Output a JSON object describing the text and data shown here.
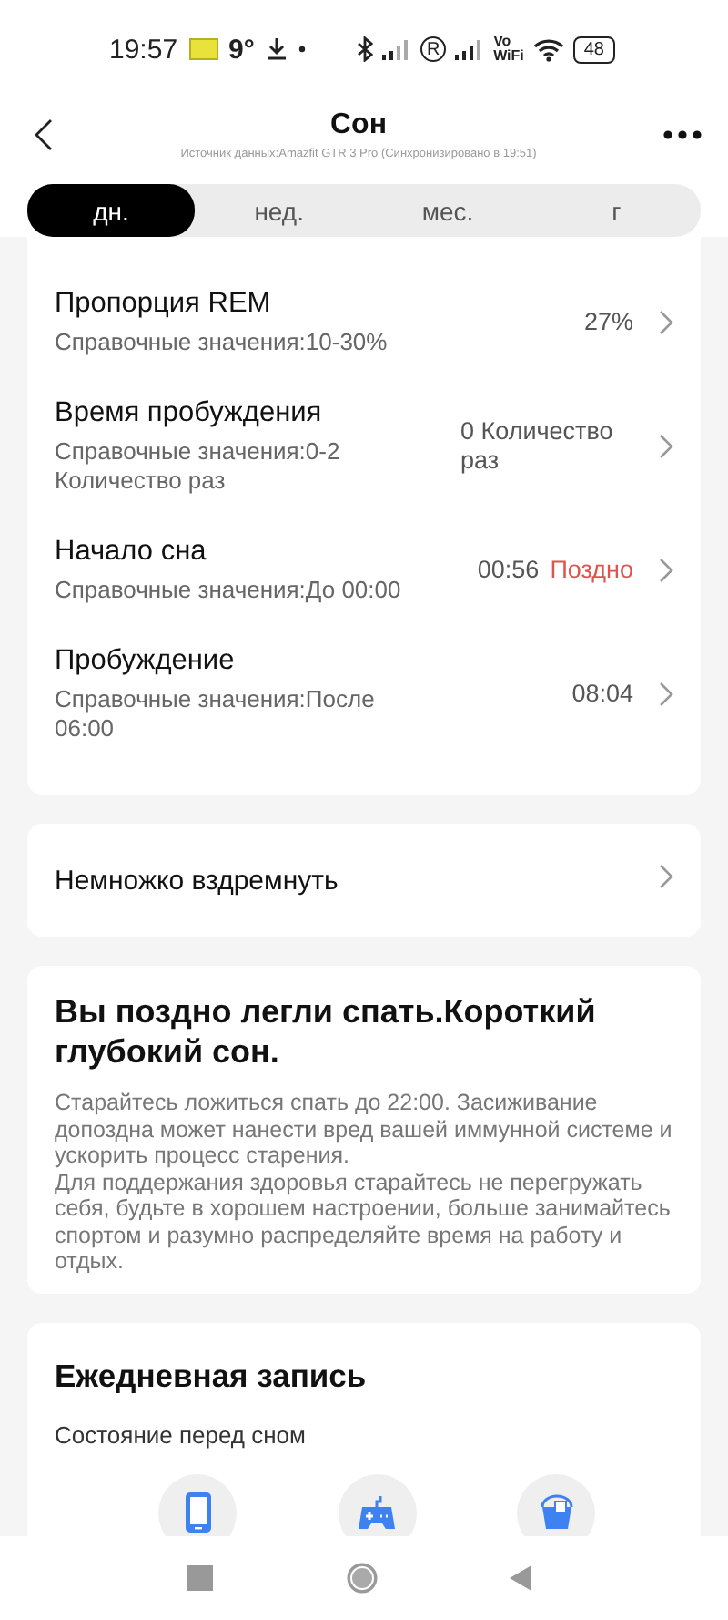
{
  "status_bar": {
    "time": "19:57",
    "temperature": "9°",
    "carrier_mark": "R",
    "vowifi_top": "Vo",
    "vowifi_bottom": "WiFi",
    "battery": "48"
  },
  "header": {
    "title": "Сон",
    "subtitle": "Источник данных:Amazfit GTR 3 Pro (Синхронизировано в 19:51)"
  },
  "tabs": [
    {
      "label": "дн.",
      "selected": true
    },
    {
      "label": "нед.",
      "selected": false
    },
    {
      "label": "мес.",
      "selected": false
    },
    {
      "label": "г",
      "selected": false
    }
  ],
  "metrics": [
    {
      "title": "Пропорция REM",
      "reference": "Справочные значения:10-30%",
      "value": "27%"
    },
    {
      "title": "Время пробуждения",
      "reference": "Справочные значения:0-2 Количество раз",
      "value": "0 Количество раз"
    },
    {
      "title": "Начало сна",
      "reference": "Справочные значения:До 00:00",
      "value": "00:56",
      "status": "Поздно",
      "color": "#e0544f"
    },
    {
      "title": "Пробуждение",
      "reference": "Справочные значения:После 06:00",
      "value": "08:04"
    }
  ],
  "nap": {
    "label": "Немножко вздремнуть"
  },
  "advice": {
    "title": "Вы поздно легли спать.Короткий глубокий сон.",
    "paragraphs": [
      "Старайтесь ложиться спать до 22:00. Засиживание допоздна может нанести вред вашей иммунной системе и ускорить процесс старения.",
      "Для поддержания здоровья старайтесь не перегружать себя, будьте в хорошем настроении, больше занимайтесь спортом и разумно распределяйте время на работу и отдых."
    ]
  },
  "daily_record": {
    "title": "Ежедневная запись",
    "subtitle": "Состояние перед сном"
  }
}
